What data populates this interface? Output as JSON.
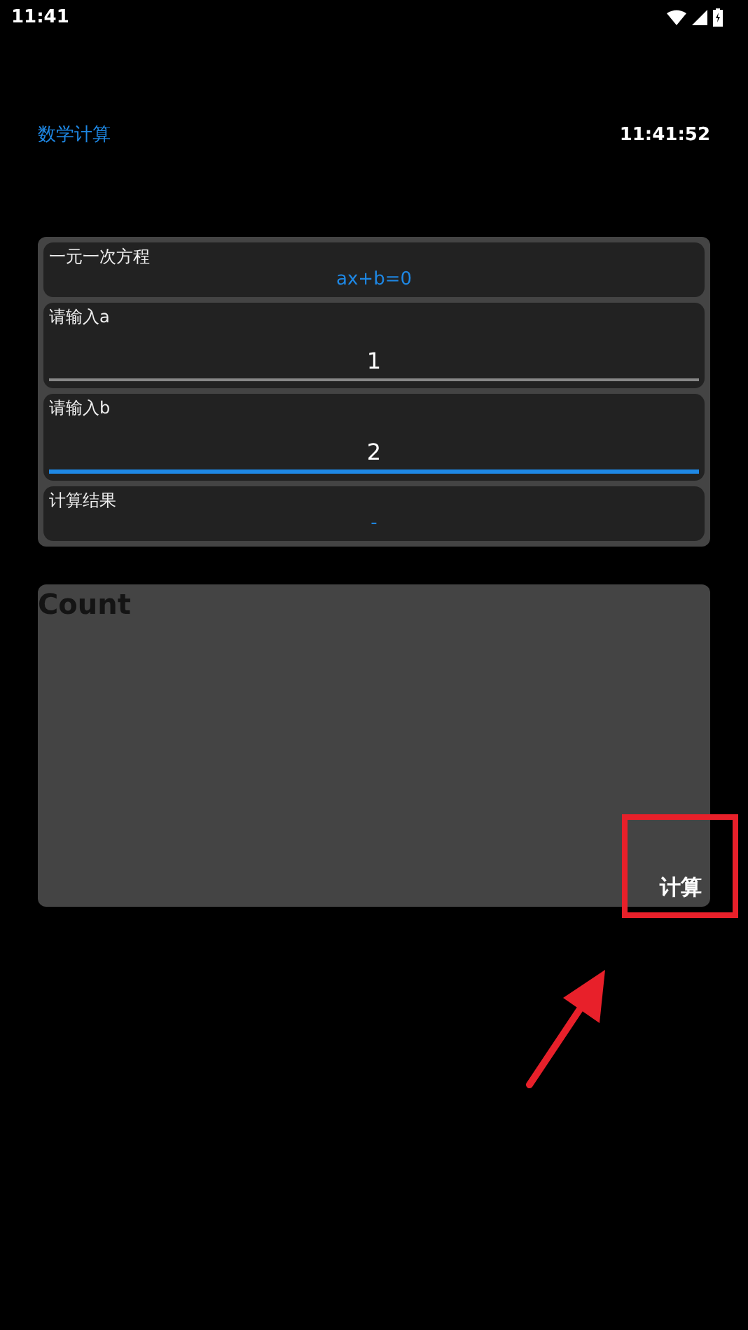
{
  "status_bar": {
    "time": "11:41"
  },
  "header": {
    "title": "数学计算",
    "clock": "11:41:52"
  },
  "form": {
    "rows": [
      {
        "kind": "info",
        "label": "一元一次方程",
        "value": "ax+b=0"
      },
      {
        "kind": "input",
        "label": "请输入a",
        "value": "1",
        "focused": false
      },
      {
        "kind": "input",
        "label": "请输入b",
        "value": "2",
        "focused": true
      },
      {
        "kind": "info",
        "label": "计算结果",
        "value": "-"
      }
    ]
  },
  "count_panel": {
    "title": "Count",
    "button": "计算"
  },
  "annotations": [
    {
      "kind": "frame"
    },
    {
      "kind": "arrow"
    }
  ]
}
